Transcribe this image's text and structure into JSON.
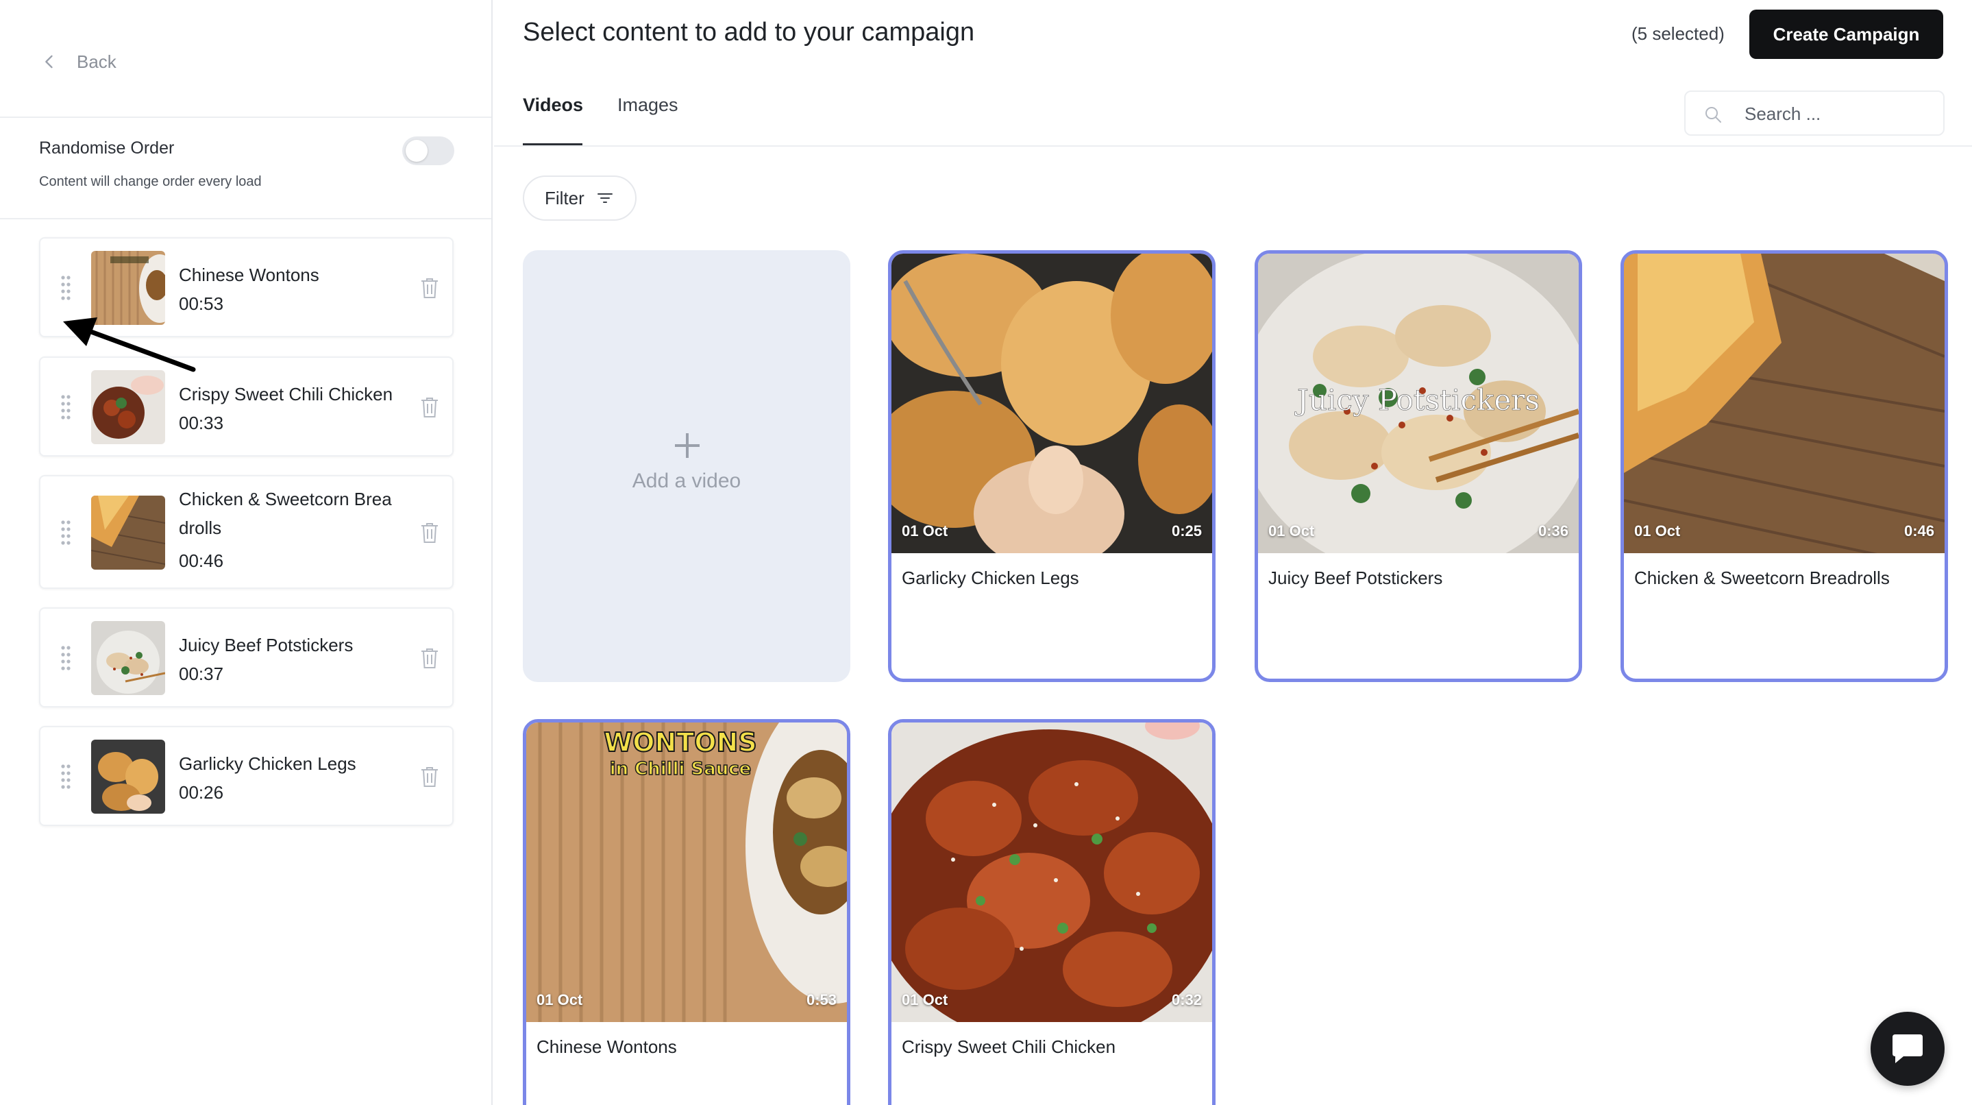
{
  "sidebar": {
    "back_label": "Back",
    "randomise": {
      "title": "Randomise Order",
      "subtitle": "Content will change order every load",
      "enabled": false
    },
    "queue": [
      {
        "title": "Chinese Wontons",
        "duration": "00:53",
        "thumb": "wontons"
      },
      {
        "title": "Crispy Sweet Chili Chicken",
        "duration": "00:33",
        "thumb": "chili"
      },
      {
        "title": "Chicken & Sweetcorn Brea drolls",
        "duration": "00:46",
        "thumb": "breadrolls"
      },
      {
        "title": "Juicy Beef Potstickers",
        "duration": "00:37",
        "thumb": "potstickers"
      },
      {
        "title": "Garlicky Chicken Legs",
        "duration": "00:26",
        "thumb": "chickenlegs"
      }
    ]
  },
  "header": {
    "title": "Select content to add to your campaign",
    "selected_count": "(5 selected)",
    "create_button": "Create Campaign"
  },
  "tabs": [
    {
      "label": "Videos",
      "active": true
    },
    {
      "label": "Images",
      "active": false
    }
  ],
  "search": {
    "placeholder": "Search ...",
    "value": ""
  },
  "filter_label": "Filter",
  "add_video_label": "Add a video",
  "videos": [
    {
      "title": "Garlicky Chicken Legs",
      "date": "01 Oct",
      "duration": "0:25",
      "selected": true
    },
    {
      "title": "Juicy Beef Potstickers",
      "date": "01 Oct",
      "duration": "0:36",
      "selected": true,
      "overlay_text": "Juicy Potstickers"
    },
    {
      "title": "Chicken & Sweetcorn Breadrolls",
      "date": "01 Oct",
      "duration": "0:46",
      "selected": true
    },
    {
      "title": "Chinese Wontons",
      "date": "01 Oct",
      "duration": "0:53",
      "selected": true,
      "overlay_text": "WONTONS",
      "overlay_subtext": "in Chilli Sauce"
    },
    {
      "title": "Crispy Sweet Chili Chicken",
      "date": "01 Oct",
      "duration": "0:32",
      "selected": true
    }
  ],
  "colors": {
    "selected_border": "#7b87e8",
    "primary_button": "#111214",
    "add_card_bg": "#e9edf5"
  },
  "icons": [
    "chevron-left-icon",
    "drag-handle-icon",
    "trash-icon",
    "search-icon",
    "filter-icon",
    "plus-icon",
    "chat-icon",
    "arrow-annotation"
  ]
}
